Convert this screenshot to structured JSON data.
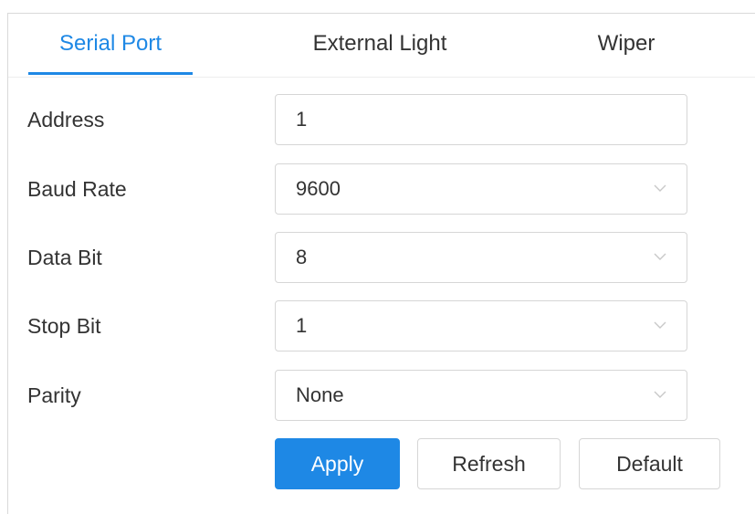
{
  "tabs": [
    {
      "label": "Serial Port",
      "active": true
    },
    {
      "label": "External Light",
      "active": false
    },
    {
      "label": "Wiper",
      "active": false
    }
  ],
  "form": {
    "address": {
      "label": "Address",
      "value": "1"
    },
    "baud_rate": {
      "label": "Baud Rate",
      "value": "9600",
      "icon": "chevron-down-icon"
    },
    "data_bit": {
      "label": "Data Bit",
      "value": "8",
      "icon": "chevron-down-icon"
    },
    "stop_bit": {
      "label": "Stop Bit",
      "value": "1",
      "icon": "chevron-down-icon"
    },
    "parity": {
      "label": "Parity",
      "value": "None",
      "icon": "chevron-down-icon"
    }
  },
  "buttons": {
    "apply": "Apply",
    "refresh": "Refresh",
    "default": "Default"
  },
  "colors": {
    "accent": "#1e88e5",
    "border": "#d6d6d6",
    "text": "#333333"
  }
}
